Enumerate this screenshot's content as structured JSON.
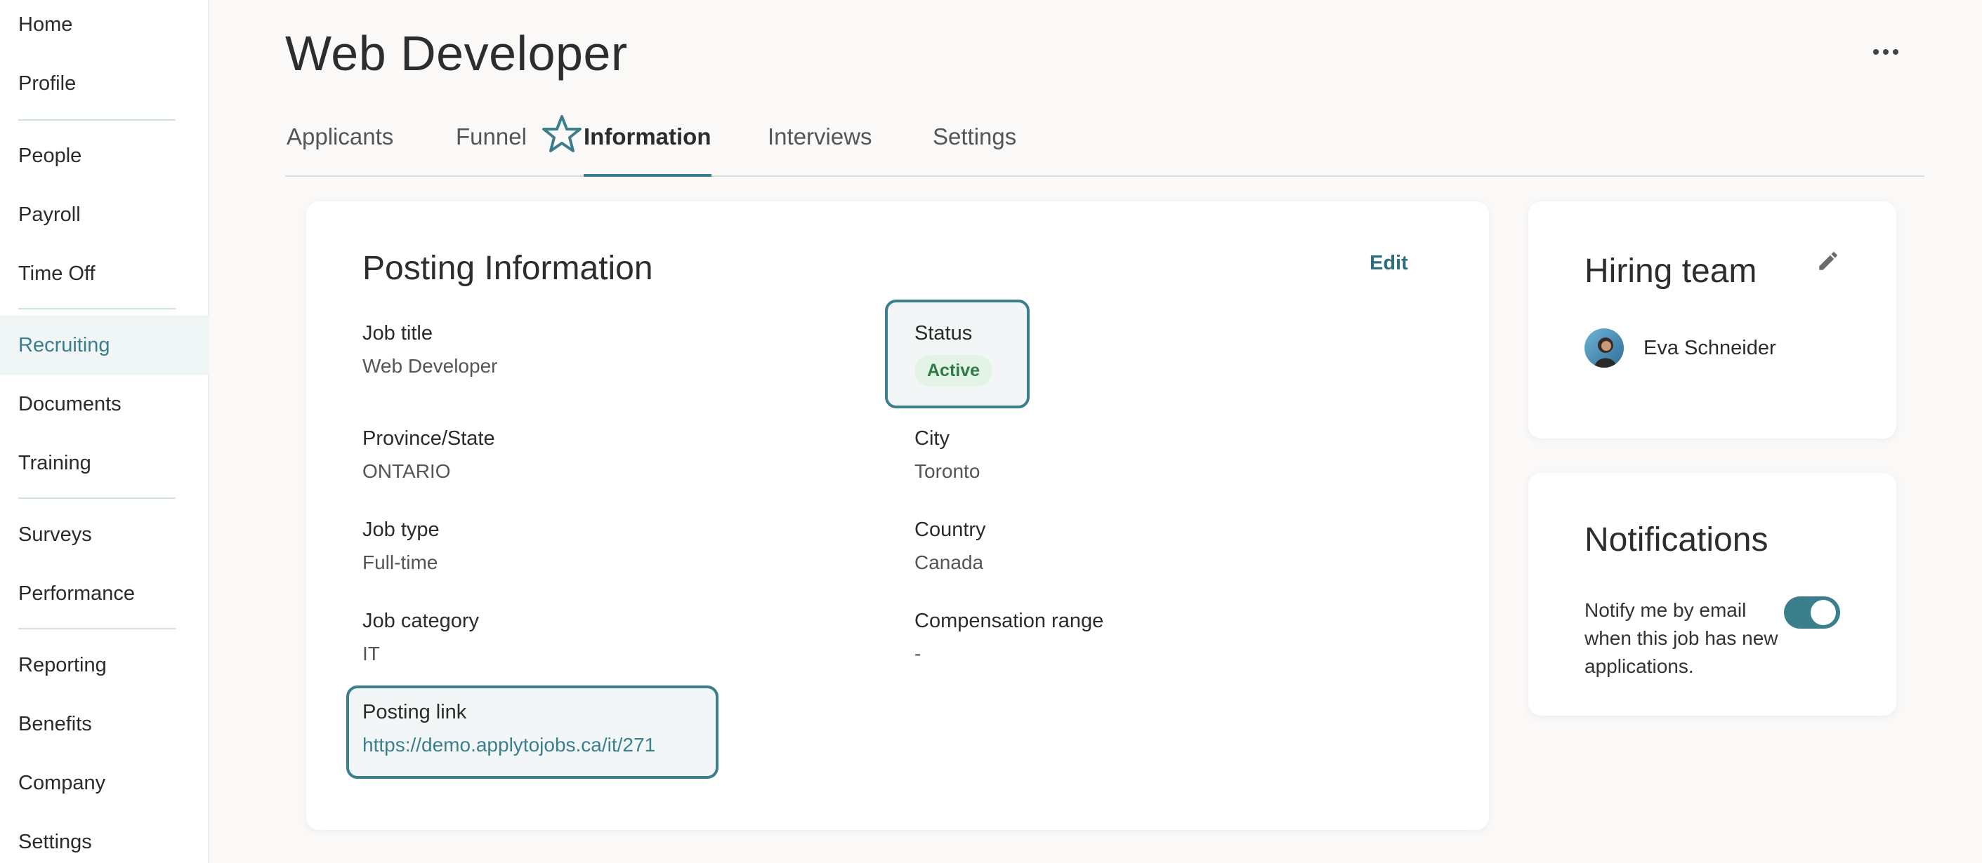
{
  "sidebar": {
    "items": [
      {
        "label": "Home"
      },
      {
        "label": "Profile"
      },
      {
        "label": "People"
      },
      {
        "label": "Payroll"
      },
      {
        "label": "Time Off"
      },
      {
        "label": "Recruiting"
      },
      {
        "label": "Documents"
      },
      {
        "label": "Training"
      },
      {
        "label": "Surveys"
      },
      {
        "label": "Performance"
      },
      {
        "label": "Reporting"
      },
      {
        "label": "Benefits"
      },
      {
        "label": "Company"
      },
      {
        "label": "Settings"
      }
    ],
    "active": "Recruiting"
  },
  "header": {
    "title": "Web Developer",
    "tabs": [
      {
        "label": "Applicants"
      },
      {
        "label": "Funnel"
      },
      {
        "label": "Information"
      },
      {
        "label": "Interviews"
      },
      {
        "label": "Settings"
      }
    ],
    "active_tab": "Information"
  },
  "posting": {
    "title": "Posting Information",
    "edit_label": "Edit",
    "fields": {
      "job_title": {
        "label": "Job title",
        "value": "Web Developer"
      },
      "status": {
        "label": "Status",
        "value": "Active"
      },
      "province": {
        "label": "Province/State",
        "value": "ONTARIO"
      },
      "city": {
        "label": "City",
        "value": "Toronto"
      },
      "job_type": {
        "label": "Job type",
        "value": "Full-time"
      },
      "country": {
        "label": "Country",
        "value": "Canada"
      },
      "job_category": {
        "label": "Job category",
        "value": "IT"
      },
      "compensation": {
        "label": "Compensation range",
        "value": "-"
      },
      "posting_link": {
        "label": "Posting link",
        "value": "https://demo.applytojobs.ca/it/271"
      }
    }
  },
  "hiring_team": {
    "title": "Hiring team",
    "members": [
      {
        "name": "Eva Schneider"
      }
    ]
  },
  "notifications": {
    "title": "Notifications",
    "text": "Notify me by email when this job has new applications.",
    "enabled": true
  },
  "colors": {
    "accent": "#3b7f8d",
    "badge_bg": "#e3f4e7",
    "badge_text": "#2f7a45"
  },
  "icons": [
    "star-icon",
    "more-icon",
    "pencil-icon",
    "avatar"
  ]
}
